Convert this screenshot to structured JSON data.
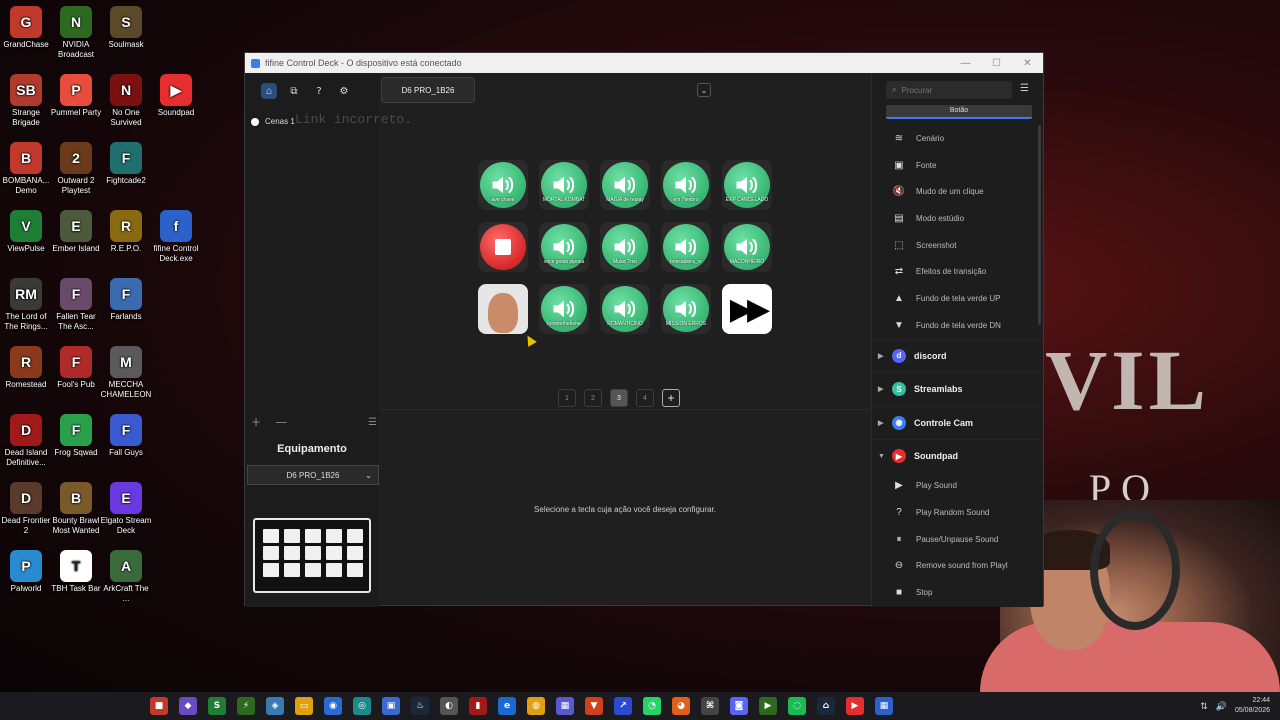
{
  "desktop": {
    "icons": [
      {
        "label": "GrandChase",
        "color": "#c0392b",
        "glyph": "G"
      },
      {
        "label": "NVIDIA Broadcast",
        "color": "#2d6a1f",
        "glyph": "N"
      },
      {
        "label": "Soulmask",
        "color": "#5a4a2a",
        "glyph": "S"
      },
      {
        "label": "Strange Brigade",
        "color": "#b03a2e",
        "glyph": "SB"
      },
      {
        "label": "Pummel Party",
        "color": "#e74c3c",
        "glyph": "P"
      },
      {
        "label": "No One Survived",
        "color": "#7a1010",
        "glyph": "N"
      },
      {
        "label": "Soundpad",
        "color": "#e52e2e",
        "glyph": "▶"
      },
      {
        "label": "BOMBANA... Demo",
        "color": "#c0392b",
        "glyph": "B"
      },
      {
        "label": "Outward 2 Playtest",
        "color": "#6b3a1a",
        "glyph": "2"
      },
      {
        "label": "Fightcade2",
        "color": "#1f6f6f",
        "glyph": "F"
      },
      {
        "label": "ViewPulse",
        "color": "#1e7e34",
        "glyph": "V"
      },
      {
        "label": "Ember Island",
        "color": "#4a5a3a",
        "glyph": "E"
      },
      {
        "label": "R.E.P.O.",
        "color": "#8a6a10",
        "glyph": "R"
      },
      {
        "label": "fifine Control Deck.exe",
        "color": "#2a62c9",
        "glyph": "f"
      },
      {
        "label": "The Lord of The Rings...",
        "color": "#3a3a3a",
        "glyph": "RM"
      },
      {
        "label": "Fallen Tear The Asc...",
        "color": "#6a4a6a",
        "glyph": "F"
      },
      {
        "label": "Farlands",
        "color": "#3a6ab0",
        "glyph": "F"
      },
      {
        "label": "Romestead",
        "color": "#8a3a1a",
        "glyph": "R"
      },
      {
        "label": "Fool's Pub",
        "color": "#b02a2a",
        "glyph": "F"
      },
      {
        "label": "MECCHA CHAMELEON",
        "color": "#5a5a5a",
        "glyph": "M"
      },
      {
        "label": "Dead Island Definitive...",
        "color": "#a01a1a",
        "glyph": "D"
      },
      {
        "label": "Frog Sqwad",
        "color": "#2aa04a",
        "glyph": "F"
      },
      {
        "label": "Fall Guys",
        "color": "#3a5ad0",
        "glyph": "F"
      },
      {
        "label": "Dead Frontier 2",
        "color": "#5a3a2a",
        "glyph": "D"
      },
      {
        "label": "Bounty Brawl Most Wanted",
        "color": "#7a5a2a",
        "glyph": "B"
      },
      {
        "label": "Elgato Stream Deck",
        "color": "#6a3ae0",
        "glyph": "E"
      },
      {
        "label": "Palworld",
        "color": "#2a8ad0",
        "glyph": "P"
      },
      {
        "label": "TBH Task Bar",
        "color": "#ffffff",
        "glyph": "T"
      },
      {
        "label": "ArkCraft The ...",
        "color": "#3a6a3a",
        "glyph": "A"
      }
    ],
    "bg_text_1": "EVIL",
    "bg_text_2": "PO"
  },
  "window": {
    "title": "fifine Control Deck - O dispositivo está conectado",
    "controls": [
      "—",
      "☐",
      "✕"
    ]
  },
  "toolbar": {
    "buttons": [
      {
        "name": "home-icon",
        "glyph": "⌂",
        "active": true
      },
      {
        "name": "plugins-icon",
        "glyph": "⧉",
        "active": false
      },
      {
        "name": "help-icon",
        "glyph": "?",
        "active": false
      },
      {
        "name": "settings-icon",
        "glyph": "⚙",
        "active": false
      }
    ]
  },
  "scenes": {
    "item_label": "Cenas 1",
    "ghost_text": "Link incorreto."
  },
  "scene_tools": {
    "add": "+",
    "remove": "—",
    "list": "☰"
  },
  "device_tab": {
    "label": "D6 PRO_1B26"
  },
  "center_dropdown": "⌄",
  "equipment": {
    "title": "Equipamento",
    "selected": "D6 PRO_1B26",
    "chevron": "⌄"
  },
  "keys": [
    {
      "type": "sound",
      "label": "ave chave"
    },
    {
      "type": "sound",
      "label": "MORTAL KOMBAT"
    },
    {
      "type": "sound",
      "label": "MAGIA de replay"
    },
    {
      "type": "sound",
      "label": "em 7tenbro"
    },
    {
      "type": "sound",
      "label": "EXP CANCELADO"
    },
    {
      "type": "stop",
      "label": ""
    },
    {
      "type": "sound",
      "label": "voce gosta pipoca"
    },
    {
      "type": "sound",
      "label": "Music Trist"
    },
    {
      "type": "sound",
      "label": "brincadeira_nr"
    },
    {
      "type": "sound",
      "label": "MACONHEIRO"
    },
    {
      "type": "photo",
      "label": ""
    },
    {
      "type": "sound",
      "label": "Inmotorhehehe"
    },
    {
      "type": "sound",
      "label": "ROMANTICINO"
    },
    {
      "type": "sound",
      "label": "MISSION ERROS"
    },
    {
      "type": "ff",
      "label": ""
    }
  ],
  "pager": {
    "pages": [
      "1",
      "2",
      "3",
      "4"
    ],
    "active": "3",
    "add": "+"
  },
  "hint": "Selecione a tecla cuja ação você deseja configurar.",
  "right_panel": {
    "search_placeholder": "Procurar",
    "tab": "Botão",
    "obs_actions": [
      {
        "icon": "layers-icon",
        "glyph": "≋",
        "label": "Cenário"
      },
      {
        "icon": "source-icon",
        "glyph": "▣",
        "label": "Fonte"
      },
      {
        "icon": "mute-icon",
        "glyph": "🔇",
        "label": "Mudo de um clique"
      },
      {
        "icon": "studio-icon",
        "glyph": "▤",
        "label": "Modo estúdio"
      },
      {
        "icon": "screenshot-icon",
        "glyph": "⬚",
        "label": "Screenshot"
      },
      {
        "icon": "transition-icon",
        "glyph": "⇄",
        "label": "Efeitos de transição"
      },
      {
        "icon": "greenscreen-up-icon",
        "glyph": "▲",
        "label": "Fundo de tela verde UP"
      },
      {
        "icon": "greenscreen-dn-icon",
        "glyph": "▼",
        "label": "Fundo de tela verde DN"
      }
    ],
    "groups": [
      {
        "name": "discord",
        "label": "discord",
        "color": "#5865f2",
        "glyph": "d",
        "expanded": false
      },
      {
        "name": "streamlabs",
        "label": "Streamlabs",
        "color": "#31c3a2",
        "glyph": "S",
        "expanded": false
      },
      {
        "name": "controle-cam",
        "label": "Controle Cam",
        "color": "#3b7cf0",
        "glyph": "◉",
        "expanded": false
      },
      {
        "name": "soundpad",
        "label": "Soundpad",
        "color": "#e52e2e",
        "glyph": "▶",
        "expanded": true
      }
    ],
    "soundpad_actions": [
      {
        "icon": "play-icon",
        "glyph": "▶",
        "label": "Play Sound"
      },
      {
        "icon": "random-icon",
        "glyph": "?",
        "label": "Play Random Sound"
      },
      {
        "icon": "pause-icon",
        "glyph": "⏸",
        "label": "Pause/Unpause Sound"
      },
      {
        "icon": "remove-icon",
        "glyph": "⊖",
        "label": "Remove sound from Playl"
      },
      {
        "icon": "stop-icon",
        "glyph": "■",
        "label": "Stop"
      }
    ]
  },
  "taskbar": {
    "date": "05/08/2026",
    "time": "22:44"
  }
}
